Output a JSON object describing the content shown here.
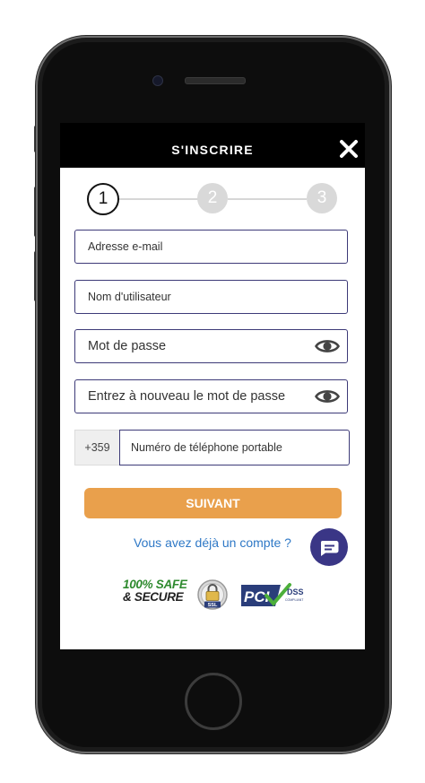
{
  "header": {
    "title": "S'INSCRIRE"
  },
  "steps": [
    "1",
    "2",
    "3"
  ],
  "form": {
    "email_placeholder": "Adresse e-mail",
    "username_placeholder": "Nom d'utilisateur",
    "password_placeholder": "Mot de passe",
    "confirm_password_placeholder": "Entrez à nouveau le mot de passe",
    "phone_prefix": "+359",
    "phone_placeholder": "Numéro de téléphone portable"
  },
  "actions": {
    "submit_label": "SUIVANT",
    "login_link": "Vous avez déjà un compte ?"
  },
  "badges": {
    "safe_line1": "100% SAFE",
    "safe_line2": "& SECURE",
    "ssl_label": "SSL",
    "pci_label": "PCI",
    "dss_label": "DSS",
    "compliant_label": "COMPLIANT"
  },
  "icons": {
    "close": "close-icon",
    "eye": "eye-icon",
    "chat": "chat-icon",
    "lock": "lock-icon",
    "check": "check-icon"
  },
  "colors": {
    "header_bg": "#000000",
    "field_border": "#3d3a78",
    "button_bg": "#e9a04c",
    "link": "#2e78c6",
    "chat_bg": "#3a3686",
    "safe_green": "#2e8a2e",
    "pci_navy": "#2a3d7a"
  }
}
